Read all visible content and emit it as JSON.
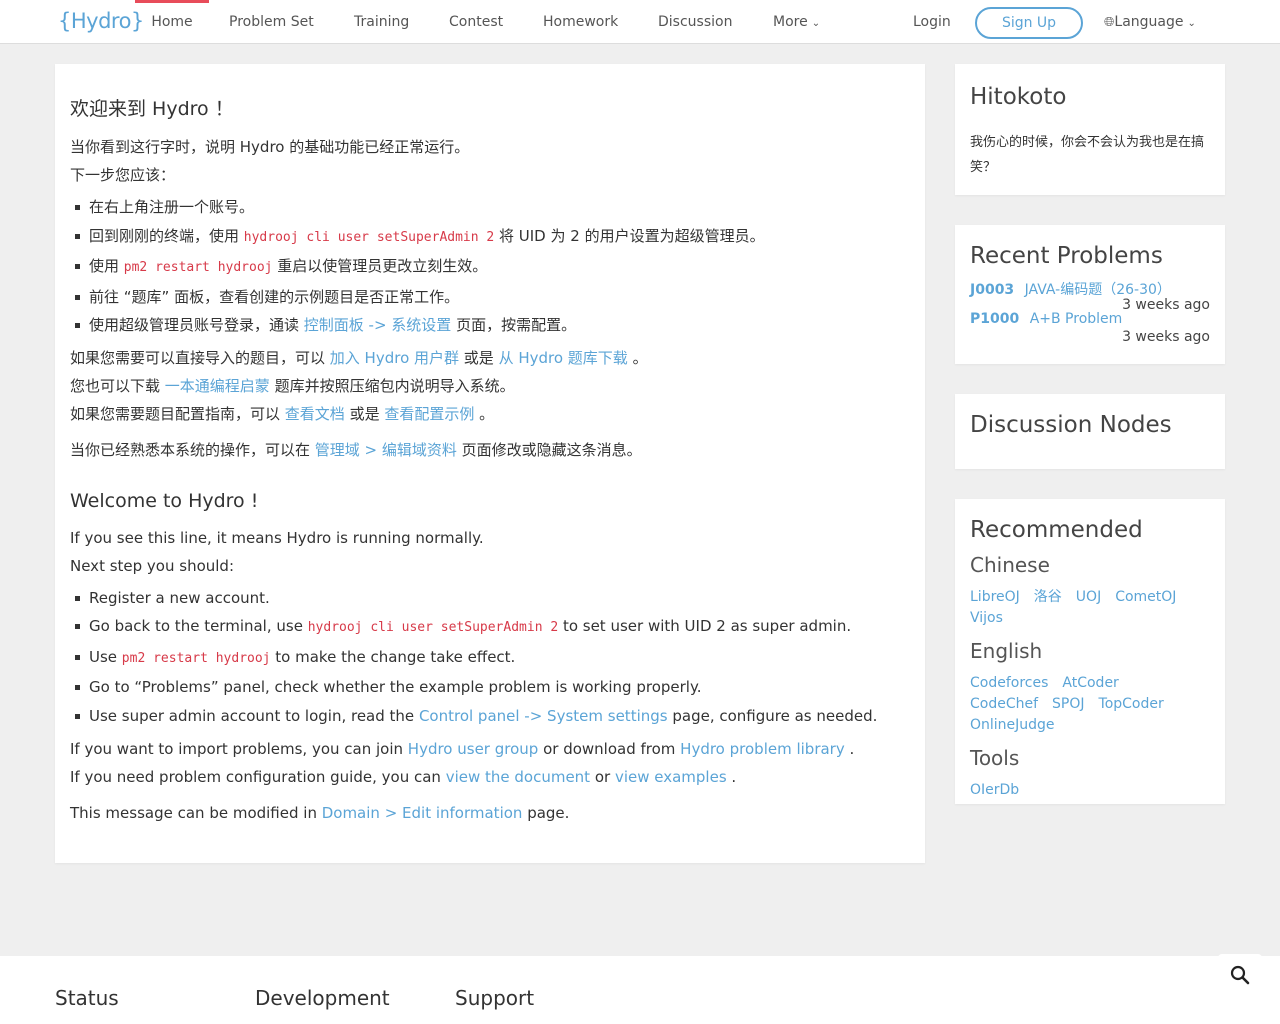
{
  "nav": {
    "logo": "{Hydro}",
    "items": [
      "Home",
      "Problem Set",
      "Training",
      "Contest",
      "Homework",
      "Discussion",
      "More"
    ],
    "login": "Login",
    "signup": "Sign Up",
    "language": "Language"
  },
  "main": {
    "zh_title": "欢迎来到 Hydro ！",
    "zh_p1": "当你看到这行字时，说明 Hydro 的基础功能已经正常运行。",
    "zh_p2": "下一步您应该：",
    "zh_li1": "在右上角注册一个账号。",
    "zh_li2_a": "回到刚刚的终端，使用 ",
    "zh_li2_code": "hydrooj cli user setSuperAdmin 2",
    "zh_li2_b": " 将 UID 为 2 的用户设置为超级管理员。",
    "zh_li3_a": "使用 ",
    "zh_li3_code": "pm2 restart hydrooj",
    "zh_li3_b": " 重启以使管理员更改立刻生效。",
    "zh_li4": "前往 “题库” 面板，查看创建的示例题目是否正常工作。",
    "zh_li5_a": "使用超级管理员账号登录，通读 ",
    "zh_li5_link": "控制面板 -> 系统设置",
    "zh_li5_b": " 页面，按需配置。",
    "zh_p3_a": "如果您需要可以直接导入的题目，可以 ",
    "zh_p3_link1": "加入 Hydro 用户群",
    "zh_p3_b": " 或是 ",
    "zh_p3_link2": "从 Hydro 题库下载",
    "zh_p3_c": " 。",
    "zh_p4_a": "您也可以下载 ",
    "zh_p4_link": "一本通编程启蒙",
    "zh_p4_b": " 题库并按照压缩包内说明导入系统。",
    "zh_p5_a": "如果您需要题目配置指南，可以 ",
    "zh_p5_link1": "查看文档",
    "zh_p5_b": " 或是 ",
    "zh_p5_link2": "查看配置示例",
    "zh_p5_c": " 。",
    "zh_p6_a": "当你已经熟悉本系统的操作，可以在 ",
    "zh_p6_link": "管理域 > 编辑域资料",
    "zh_p6_b": " 页面修改或隐藏这条消息。",
    "en_title": "Welcome to Hydro !",
    "en_p1": "If you see this line, it means Hydro is running normally.",
    "en_p2": "Next step you should:",
    "en_li1": "Register a new account.",
    "en_li2_a": "Go back to the terminal, use ",
    "en_li2_code": "hydrooj cli user setSuperAdmin 2",
    "en_li2_b": " to set user with UID 2 as super admin.",
    "en_li3_a": "Use ",
    "en_li3_code": "pm2 restart hydrooj",
    "en_li3_b": " to make the change take effect.",
    "en_li4": "Go to “Problems” panel, check whether the example problem is working properly.",
    "en_li5_a": "Use super admin account to login, read the ",
    "en_li5_link": "Control panel -> System settings",
    "en_li5_b": " page, configure as needed.",
    "en_p3_a": "If you want to import problems, you can join ",
    "en_p3_link1": "Hydro user group",
    "en_p3_b": " or download from ",
    "en_p3_link2": "Hydro problem library",
    "en_p3_c": " .",
    "en_p4_a": "If you need problem configuration guide, you can ",
    "en_p4_link1": "view the document",
    "en_p4_b": " or ",
    "en_p4_link2": "view examples",
    "en_p4_c": " .",
    "en_p5_a": "This message can be modified in ",
    "en_p5_link": "Domain > Edit information",
    "en_p5_b": " page."
  },
  "sidebar": {
    "hitokoto": {
      "title": "Hitokoto",
      "text": "我伤心的时候，你会不会认为我也是在搞笑？"
    },
    "recent": {
      "title": "Recent Problems",
      "items": [
        {
          "id": "J0003",
          "name": "JAVA-编码题（26-30）",
          "time": "3 weeks ago"
        },
        {
          "id": "P1000",
          "name": "A+B Problem",
          "time": "3 weeks ago"
        }
      ]
    },
    "discussion": {
      "title": "Discussion Nodes"
    },
    "recommended": {
      "title": "Recommended",
      "chinese": {
        "title": "Chinese",
        "links": [
          "LibreOJ",
          "洛谷",
          "UOJ",
          "CometOJ",
          "Vijos"
        ]
      },
      "english": {
        "title": "English",
        "links": [
          "Codeforces",
          "AtCoder",
          "CodeChef",
          "SPOJ",
          "TopCoder",
          "OnlineJudge"
        ]
      },
      "tools": {
        "title": "Tools",
        "links": [
          "OIerDb"
        ]
      }
    }
  },
  "footer": {
    "status": "Status",
    "development": "Development",
    "support": "Support"
  },
  "colors": {
    "accent": "#5ba4d6",
    "active_tab": "#e84c5a",
    "code": "#d73a49"
  }
}
